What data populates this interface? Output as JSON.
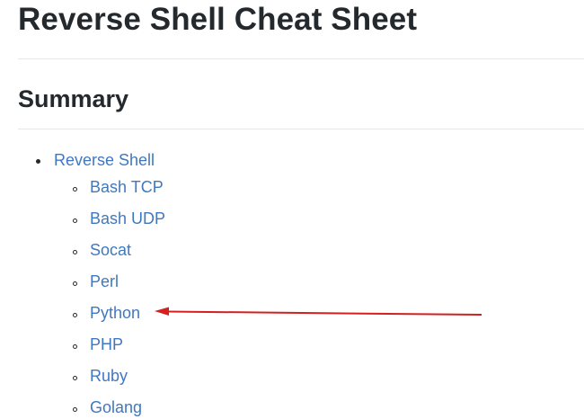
{
  "document": {
    "title": "Reverse Shell Cheat Sheet",
    "summary_heading": "Summary"
  },
  "toc": {
    "top_item": "Reverse Shell",
    "sub_items": [
      {
        "label": "Bash TCP"
      },
      {
        "label": "Bash UDP"
      },
      {
        "label": "Socat"
      },
      {
        "label": "Perl"
      },
      {
        "label": "Python"
      },
      {
        "label": "PHP"
      },
      {
        "label": "Ruby"
      },
      {
        "label": "Golang"
      }
    ]
  },
  "annotation": {
    "arrow_color": "#d32020",
    "points_to": "Python"
  },
  "colors": {
    "link": "#4078c0",
    "heading": "#24292e",
    "rule": "#e4e6e8"
  }
}
